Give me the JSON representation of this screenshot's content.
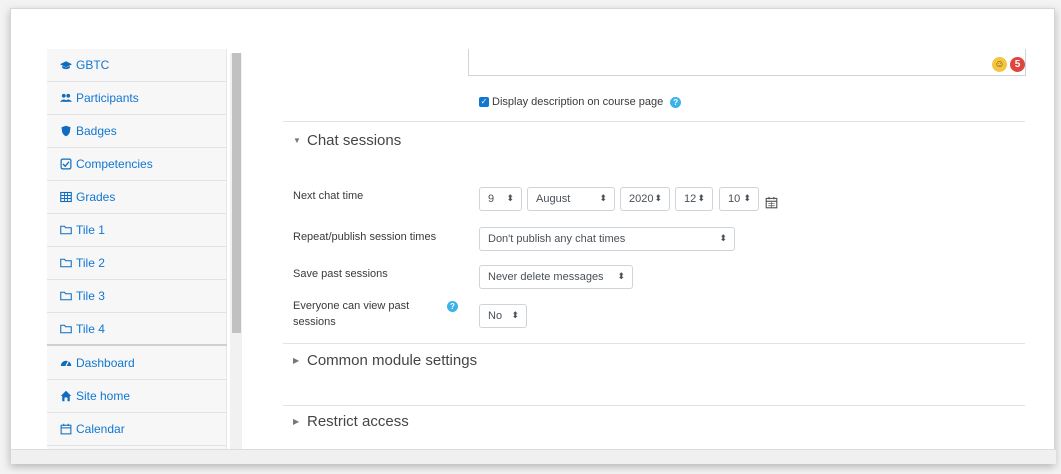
{
  "sidebar": {
    "items": [
      {
        "label": "GBTC",
        "icon": "graduation-cap-icon"
      },
      {
        "label": "Participants",
        "icon": "users-icon"
      },
      {
        "label": "Badges",
        "icon": "shield-icon"
      },
      {
        "label": "Competencies",
        "icon": "check-square-icon"
      },
      {
        "label": "Grades",
        "icon": "table-icon"
      },
      {
        "label": "Tile 1",
        "icon": "folder-icon"
      },
      {
        "label": "Tile 2",
        "icon": "folder-icon"
      },
      {
        "label": "Tile 3",
        "icon": "folder-icon"
      },
      {
        "label": "Tile 4",
        "icon": "folder-icon"
      },
      {
        "label": "Dashboard",
        "icon": "tachometer-icon"
      },
      {
        "label": "Site home",
        "icon": "home-icon"
      },
      {
        "label": "Calendar",
        "icon": "calendar-icon"
      }
    ]
  },
  "description": {
    "emoji_badge_count": "5",
    "display_on_course_page_label": "Display description on course page",
    "display_on_course_page_checked": true
  },
  "chat_sessions": {
    "title": "Chat sessions",
    "next_chat_time": {
      "label": "Next chat time",
      "day": "9",
      "month": "August",
      "year": "2020",
      "hour": "12",
      "minute": "10"
    },
    "repeat_publish": {
      "label": "Repeat/publish session times",
      "value": "Don't publish any chat times"
    },
    "save_past_sessions": {
      "label": "Save past sessions",
      "value": "Never delete messages"
    },
    "everyone_can_view": {
      "label_line1": "Everyone can view past",
      "label_line2": "sessions",
      "value": "No"
    }
  },
  "common_module_settings": {
    "title": "Common module settings"
  },
  "restrict_access": {
    "title": "Restrict access"
  },
  "colors": {
    "link": "#1177d1",
    "help": "#3ab3e8",
    "badge": "#e0443e"
  }
}
